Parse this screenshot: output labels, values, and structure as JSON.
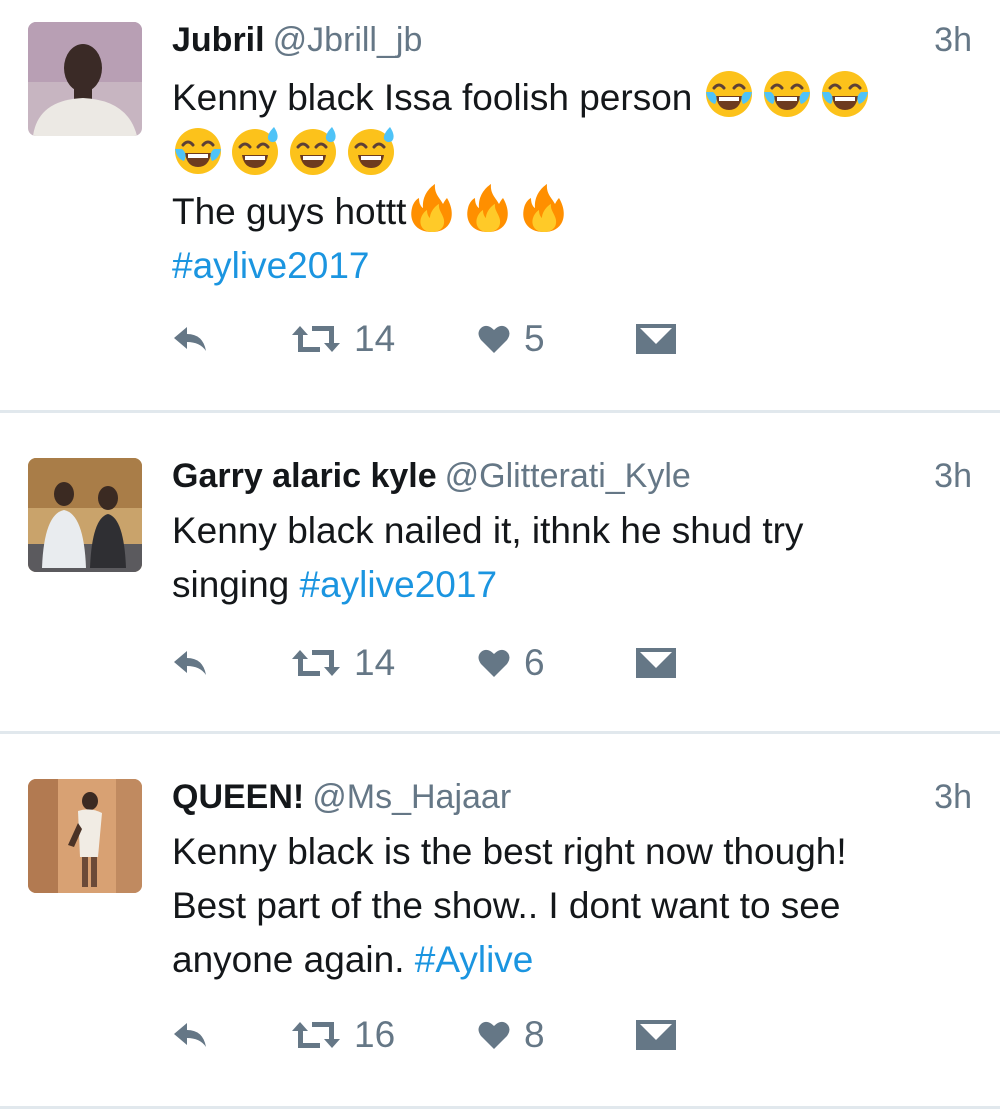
{
  "tweets": [
    {
      "name": "Jubril",
      "handle": "@Jbrill_jb",
      "time": "3h",
      "text_line1": "Kenny black Issa  foolish person ",
      "text_line3": "The guys hottt",
      "hashtag": "#aylive2017",
      "retweets": "14",
      "likes": "5"
    },
    {
      "name": "Garry alaric kyle",
      "handle": "@Glitterati_Kyle",
      "time": "3h",
      "text_line1": "Kenny black nailed it, ithnk he shud try",
      "text_line2": "singing ",
      "hashtag": "#aylive2017",
      "retweets": "14",
      "likes": "6"
    },
    {
      "name": "QUEEN!",
      "handle": "@Ms_Hajaar",
      "time": "3h",
      "text_line1": "Kenny black is the best  right now though!",
      "text_line2": "Best part of the show..  I dont want to see",
      "text_line3": "anyone again. ",
      "hashtag": "#Aylive",
      "retweets": "16",
      "likes": "8"
    }
  ],
  "icons": {
    "reply": "reply-icon",
    "retweet": "retweet-icon",
    "like": "heart-icon",
    "dm": "direct-message-icon",
    "tears_of_joy": "face-with-tears-of-joy-emoji",
    "sweat_smile": "grinning-face-with-sweat-emoji",
    "fire": "fire-emoji"
  },
  "colors": {
    "hashtag": "#1b95e0",
    "secondary_text": "#657786",
    "divider": "#e1e8ed"
  }
}
